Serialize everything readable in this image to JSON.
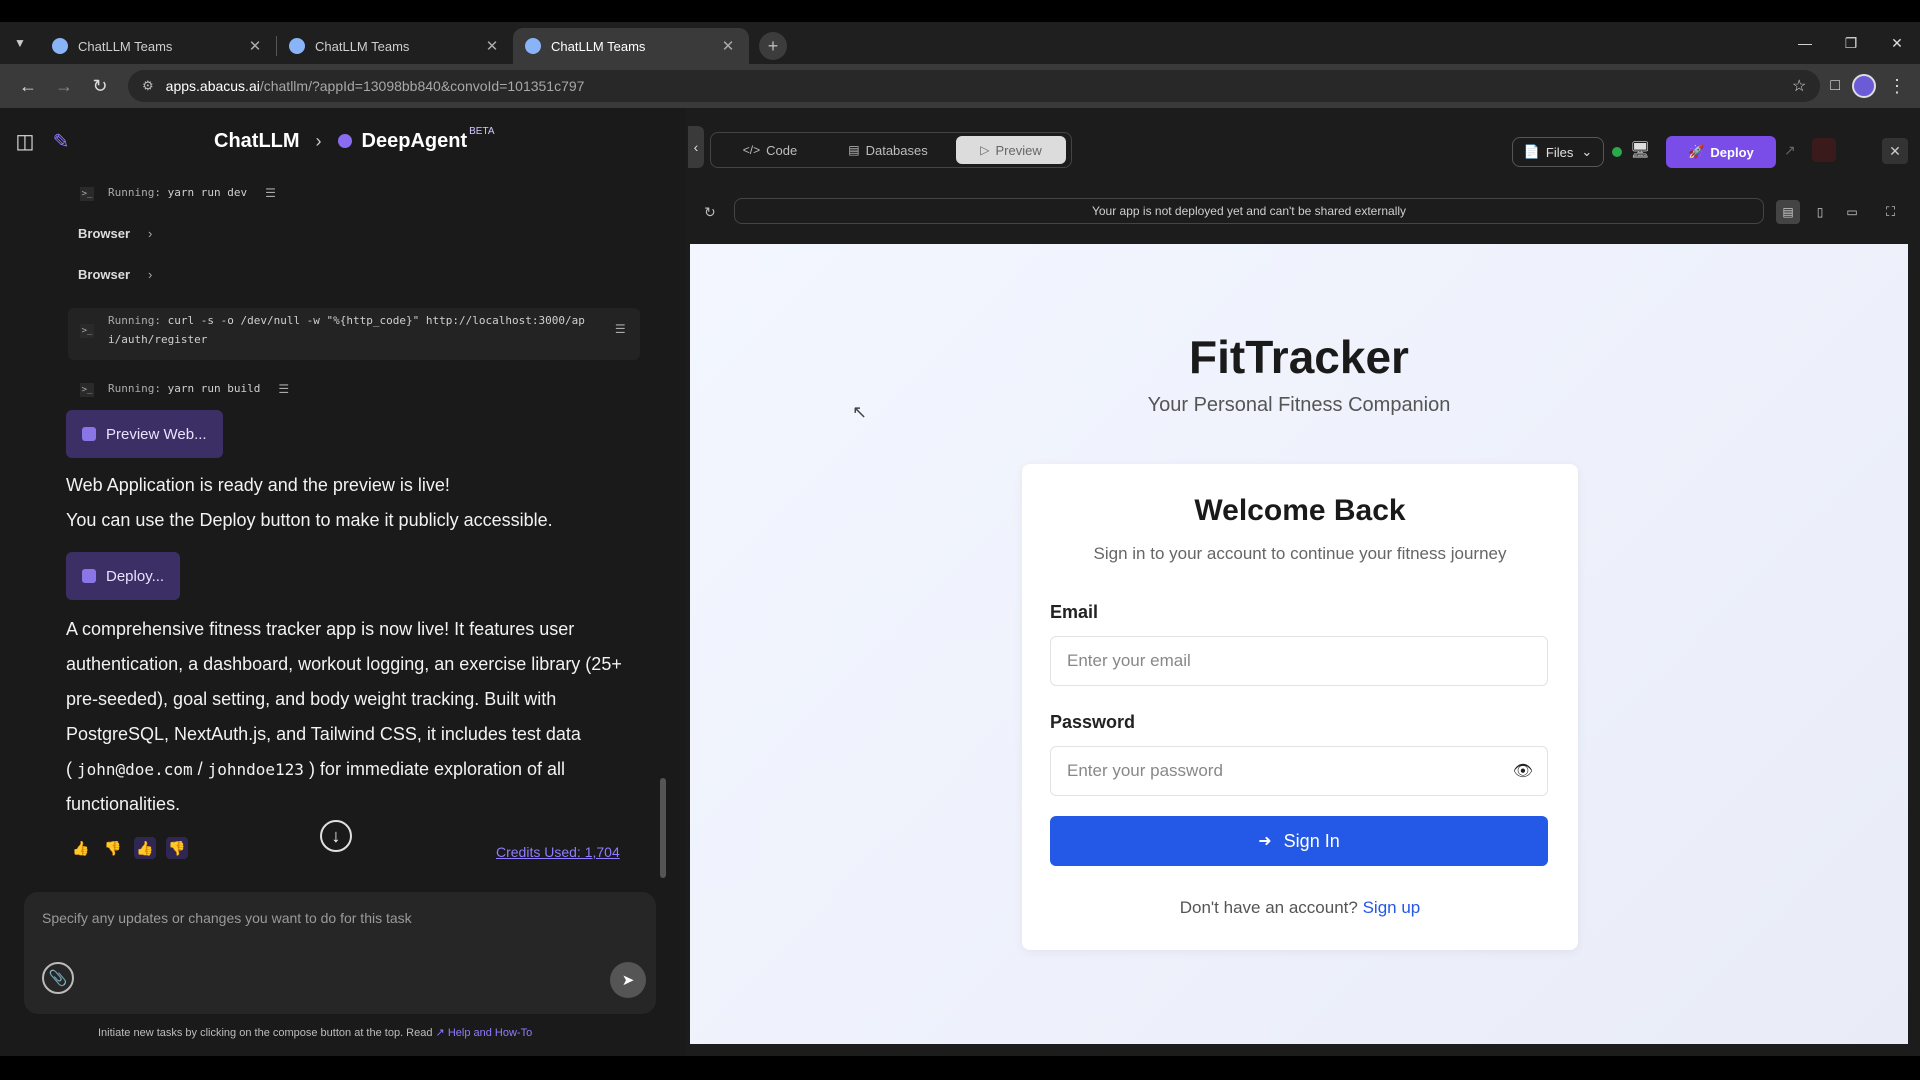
{
  "browser": {
    "tabs": [
      {
        "title": "ChatLLM Teams",
        "active": false
      },
      {
        "title": "ChatLLM Teams",
        "active": false
      },
      {
        "title": "ChatLLM Teams",
        "active": true
      }
    ],
    "url_host": "apps.abacus.ai",
    "url_rest": "/chatllm/?appId=13098bb840&convoId=101351c797"
  },
  "left": {
    "breadcrumb_root": "ChatLLM",
    "breadcrumb_agent": "DeepAgent",
    "beta_badge": "BETA",
    "commands": [
      {
        "label": "Running:",
        "cmd": "yarn run dev"
      },
      {
        "label": "Running:",
        "cmd": "curl -s -o /dev/null -w \"%{http_code}\" http://localhost:3000/ap",
        "cmd2": "i/auth/register"
      },
      {
        "label": "Running:",
        "cmd": "yarn run build"
      }
    ],
    "browser_items": [
      "Browser",
      "Browser"
    ],
    "preview_button": "Preview Web...",
    "ready_line1": "Web Application is ready and the preview is live!",
    "ready_line2": "You can use the Deploy button to make it publicly accessible.",
    "deploy_button": "Deploy...",
    "summary": {
      "l1": "A comprehensive fitness tracker app is now live! It features user",
      "l2": "authentication, a dashboard, workout logging, an exercise library (25+",
      "l3": "pre-seeded), goal setting, and body weight tracking. Built with",
      "l4": "PostgreSQL, NextAuth.js, and Tailwind CSS, it includes test data",
      "l5_open": "( ",
      "l5_email": "john@doe.com",
      "l5_sep": " / ",
      "l5_pass": "johndoe123",
      "l5_close": " ) for immediate exploration of all",
      "l6": "functionalities."
    },
    "credits": "Credits Used: 1,704",
    "composer_placeholder": "Specify any updates or changes you want to do for this task",
    "footer_note": "Initiate new tasks by clicking on the compose button at the top. Read",
    "footer_link": "Help and How-To"
  },
  "right": {
    "tabs": {
      "code": "Code",
      "databases": "Databases",
      "preview": "Preview"
    },
    "files": "Files",
    "deploy": "Deploy",
    "notice": "Your app is not deployed yet and can't be shared externally",
    "app": {
      "title": "FitTracker",
      "subtitle": "Your Personal Fitness Companion",
      "card_title": "Welcome Back",
      "card_sub": "Sign in to your account to continue your fitness journey",
      "email_label": "Email",
      "email_placeholder": "Enter your email",
      "password_label": "Password",
      "password_placeholder": "Enter your password",
      "signin": "Sign In",
      "no_account": "Don't have an account?",
      "signup": "Sign up"
    }
  }
}
